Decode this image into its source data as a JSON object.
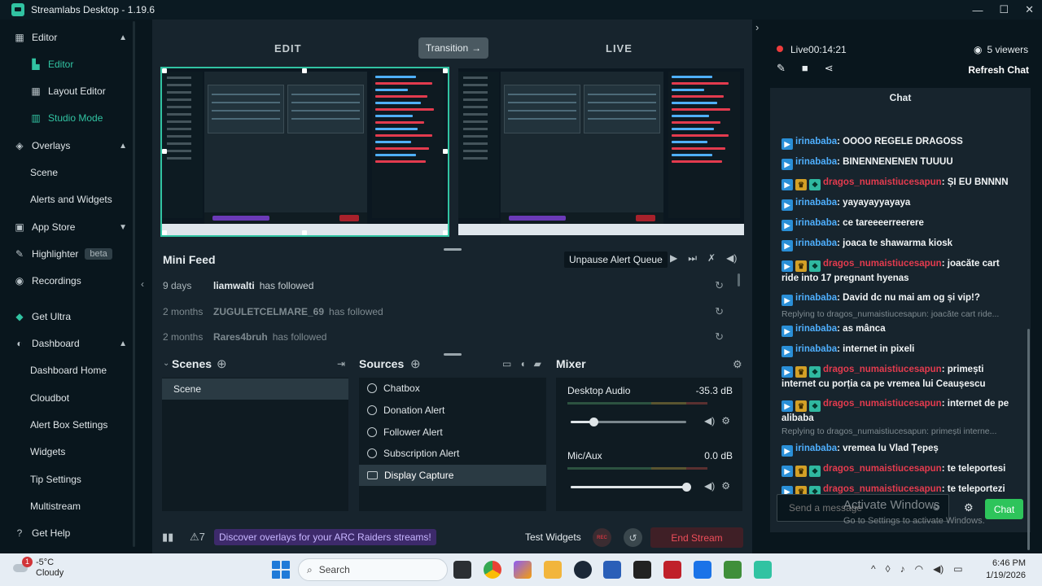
{
  "window": {
    "title": "Streamlabs Desktop - 1.19.6",
    "controls": [
      "—",
      "☐",
      "✕"
    ]
  },
  "nav": {
    "editor_group": "Editor",
    "editor": "Editor",
    "layout_editor": "Layout Editor",
    "studio_mode": "Studio Mode",
    "overlays_group": "Overlays",
    "scene": "Scene",
    "alerts_widgets": "Alerts and Widgets",
    "app_store": "App Store",
    "highlighter": "Highlighter",
    "highlighter_badge": "beta",
    "recordings": "Recordings",
    "get_ultra": "Get Ultra",
    "dashboard_group": "Dashboard",
    "dashboard_home": "Dashboard Home",
    "cloudbot": "Cloudbot",
    "alert_box_settings": "Alert Box Settings",
    "widgets": "Widgets",
    "tip_settings": "Tip Settings",
    "multistream": "Multistream",
    "get_help": "Get Help"
  },
  "studio": {
    "edit_label": "EDIT",
    "live_label": "LIVE",
    "transition_label": "Transition",
    "transition_arrow": "→"
  },
  "mini_feed": {
    "title": "Mini Feed",
    "unpause_label": "Unpause Alert Queue",
    "items": [
      {
        "time": "9 days",
        "user": "liamwalti",
        "action": "has followed"
      },
      {
        "time": "2 months",
        "user": "ZUGULETCELMARE_69",
        "action": "has followed"
      },
      {
        "time": "2 months",
        "user": "Rares4bruh",
        "action": "has followed"
      }
    ]
  },
  "scenes": {
    "title": "Scenes",
    "items": [
      "Scene"
    ]
  },
  "sources": {
    "title": "Sources",
    "items": [
      "Chatbox",
      "Donation Alert",
      "Follower Alert",
      "Subscription Alert",
      "Display Capture"
    ],
    "selected_index": 4
  },
  "mixer": {
    "title": "Mixer",
    "channels": [
      {
        "name": "Desktop Audio",
        "db": "-35.3 dB",
        "level": 0.2
      },
      {
        "name": "Mic/Aux",
        "db": "0.0 dB",
        "level": 1.0
      }
    ]
  },
  "bottom_bar": {
    "alert_count": "7",
    "promo": "Discover overlays for your ARC Raiders streams!",
    "test_widgets": "Test Widgets",
    "rec_label": "REC",
    "end_stream": "End Stream"
  },
  "chat_panel": {
    "live_status": "Live",
    "live_time": "00:14:21",
    "viewers": "5 viewers",
    "refresh_chat": "Refresh Chat",
    "chat_title": "Chat",
    "input_placeholder": "Send a message",
    "send_label": "Chat",
    "messages": [
      {
        "user": "irinababa",
        "color": "blue",
        "badges": [
          "prime"
        ],
        "text": "OOOO REGELE DRAGOSS"
      },
      {
        "user": "irinababa",
        "color": "blue",
        "badges": [
          "prime"
        ],
        "text": "BINENNENENEN TUUUU"
      },
      {
        "user": "dragos_numaistiucesapun",
        "color": "red",
        "badges": [
          "prime",
          "crown",
          "sub"
        ],
        "text": "ȘI EU BNNNN"
      },
      {
        "user": "irinababa",
        "color": "blue",
        "badges": [
          "prime"
        ],
        "text": "yayayayyayaya"
      },
      {
        "user": "irinababa",
        "color": "blue",
        "badges": [
          "prime"
        ],
        "text": "ce tareeeerreerere"
      },
      {
        "user": "irinababa",
        "color": "blue",
        "badges": [
          "prime"
        ],
        "text": "joaca te shawarma kiosk"
      },
      {
        "user": "dragos_numaistiucesapun",
        "color": "red",
        "badges": [
          "prime",
          "crown",
          "sub"
        ],
        "text": "joacăte cart ride into 17 pregnant hyenas"
      },
      {
        "user": "irinababa",
        "color": "blue",
        "badges": [
          "prime"
        ],
        "text": "David dc nu mai am og și vip!?"
      },
      {
        "reply": "Replying to dragos_numaistiucesapun: joacăte cart ride..."
      },
      {
        "user": "irinababa",
        "color": "blue",
        "badges": [
          "prime"
        ],
        "text": "as mânca"
      },
      {
        "user": "irinababa",
        "color": "blue",
        "badges": [
          "prime"
        ],
        "text": "internet in pixeli"
      },
      {
        "user": "dragos_numaistiucesapun",
        "color": "red",
        "badges": [
          "prime",
          "crown",
          "sub"
        ],
        "text": "primești internet cu porția ca pe vremea lui Ceaușescu"
      },
      {
        "user": "dragos_numaistiucesapun",
        "color": "red",
        "badges": [
          "prime",
          "crown",
          "sub"
        ],
        "text": "internet de pe alibaba"
      },
      {
        "reply": "Replying to dragos_numaistiucesapun: primești interne..."
      },
      {
        "user": "irinababa",
        "color": "blue",
        "badges": [
          "prime"
        ],
        "text": "vremea lu Vlad Țepeș"
      },
      {
        "user": "dragos_numaistiucesapun",
        "color": "red",
        "badges": [
          "prime",
          "crown",
          "sub"
        ],
        "text": "te teleportesi"
      },
      {
        "user": "dragos_numaistiucesapun",
        "color": "red",
        "badges": [
          "prime",
          "crown",
          "sub"
        ],
        "text": "te teleportezi pe ecranu celuilalt"
      }
    ],
    "watermark_title": "Activate Windows",
    "watermark_sub": "Go to Settings to activate Windows."
  },
  "taskbar": {
    "weather_temp": "-5°C",
    "weather_desc": "Cloudy",
    "weather_badge": "1",
    "search_placeholder": "Search",
    "time": "6:46 PM",
    "date": "1/19/2026"
  },
  "colors": {
    "accent": "#31c3a2",
    "end_stream": "#ee4e5a",
    "user_blue": "#4fb0ff",
    "user_red": "#e33b4e",
    "promo_bg": "#3d2a6b"
  }
}
